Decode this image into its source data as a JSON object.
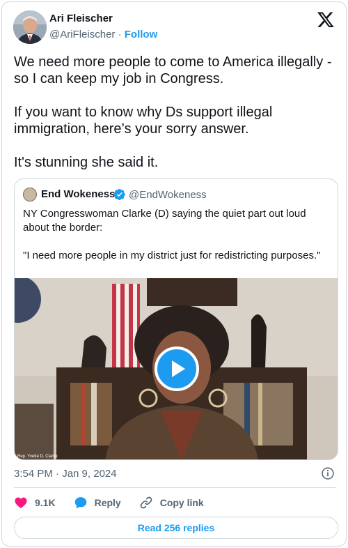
{
  "author": {
    "name": "Ari Fleischer",
    "handle": "@AriFleischer",
    "separator": "·",
    "follow_label": "Follow"
  },
  "tweet": {
    "paragraphs": [
      "We need more people to come to America illegally - so I can keep my job in Congress.",
      "If you want to know why Ds support illegal immigration, here’s your sorry answer.",
      "It's stunning she said it."
    ],
    "timestamp": "3:54 PM · Jan 9, 2024"
  },
  "quote": {
    "name": "End Wokeness",
    "handle": "@EndWokeness",
    "paragraphs": [
      "NY Congresswoman Clarke (D) saying the quiet part out loud about the border:",
      "\"I need more people in my district just for redistricting purposes.\""
    ],
    "video_caption": "Rep. Yvette D. Clarke"
  },
  "actions": {
    "likes": "9.1K",
    "reply_label": "Reply",
    "copy_label": "Copy link",
    "replies_button": "Read 256 replies"
  },
  "icons": {
    "logo": "x-logo-icon",
    "verified": "verified-badge-icon",
    "like": "heart-icon",
    "reply": "speech-bubble-icon",
    "copy": "link-icon",
    "info": "info-icon",
    "play": "play-icon"
  },
  "colors": {
    "accent": "#1d9bf0",
    "like": "#f91880",
    "muted": "#536471",
    "border": "#cfd9de"
  }
}
